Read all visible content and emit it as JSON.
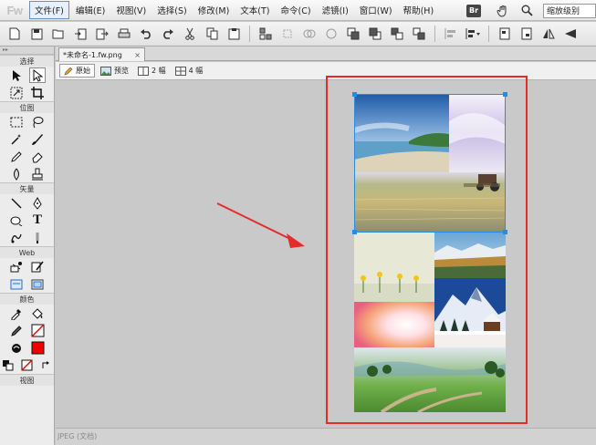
{
  "app": {
    "logo": "Fw",
    "badge": "Br"
  },
  "menu": [
    {
      "label": "文件(F)",
      "active": true
    },
    {
      "label": "编辑(E)"
    },
    {
      "label": "视图(V)"
    },
    {
      "label": "选择(S)"
    },
    {
      "label": "修改(M)"
    },
    {
      "label": "文本(T)"
    },
    {
      "label": "命令(C)"
    },
    {
      "label": "滤镜(I)"
    },
    {
      "label": "窗口(W)"
    },
    {
      "label": "帮助(H)"
    }
  ],
  "zoom": {
    "label": "缩放级别"
  },
  "document": {
    "tab_title": "*未命名-1.fw.png",
    "close_glyph": "×"
  },
  "view_modes": [
    {
      "label": "原始",
      "active": true,
      "icon": "pencil-icon"
    },
    {
      "label": "预览",
      "icon": "image-icon"
    },
    {
      "label": "2 幅",
      "icon": "two-up-icon"
    },
    {
      "label": "4 幅",
      "icon": "four-up-icon"
    }
  ],
  "tools": {
    "sections": [
      "选择",
      "位图",
      "矢量",
      "Web",
      "颜色",
      "视图"
    ],
    "stroke_color": "#222222",
    "fill_color": "#e60000"
  },
  "status": {
    "text": "JPEG (文档)"
  },
  "colors": {
    "annotation_red": "#e62b2b",
    "selection_blue": "#2a8cde"
  }
}
